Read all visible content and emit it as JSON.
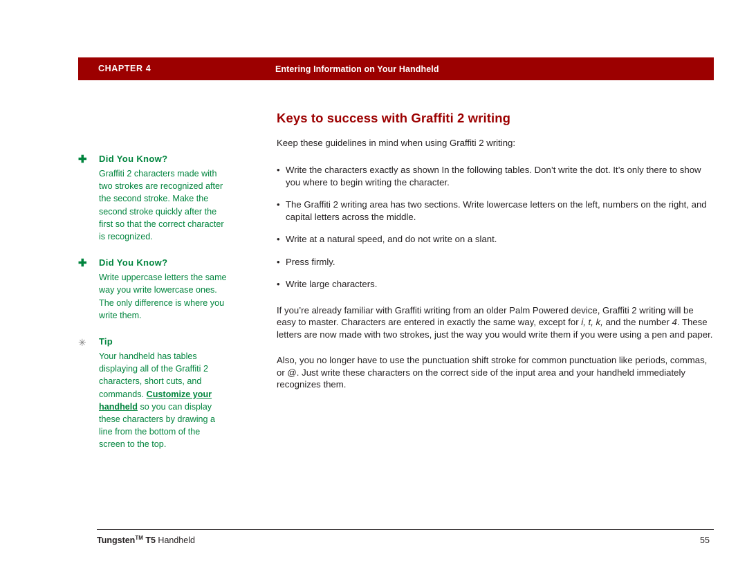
{
  "header": {
    "chapter_label": "CHAPTER 4",
    "section_title": "Entering Information on Your Handheld",
    "bar_color": "#9C0000"
  },
  "sidebar": {
    "accent_color": "#00843D",
    "notes": [
      {
        "marker": "plus-icon",
        "marker_glyph": "✚",
        "heading": "Did You Know?",
        "body": "Graffiti 2 characters made with two strokes are recognized after the second stroke. Make the second stroke quickly after the first so that the correct character is recognized."
      },
      {
        "marker": "plus-icon",
        "marker_glyph": "✚",
        "heading": "Did You Know?",
        "body": "Write uppercase letters the same way you write lowercase ones. The only difference is where you write them."
      },
      {
        "marker": "asterisk-icon",
        "marker_glyph": "✳",
        "heading": "Tip",
        "body_before_link": "Your handheld has tables displaying all of the Graffiti 2 characters, short cuts, and commands. ",
        "link_text": "Customize your handheld",
        "body_after_link": " so you can display these characters by drawing a line from the bottom of the screen to the top."
      }
    ]
  },
  "main": {
    "title": "Keys to success with Graffiti 2 writing",
    "title_color": "#9C0000",
    "intro": "Keep these guidelines in mind when using Graffiti 2 writing:",
    "bullets": [
      "Write the characters exactly as shown In the following tables. Don’t write the dot. It’s only there to show you where to begin writing the character.",
      "The Graffiti 2 writing area has two sections. Write lowercase letters on the left, numbers on the right, and capital letters across the middle.",
      "Write at a natural speed, and do not write on a slant.",
      "Press firmly.",
      "Write large characters."
    ],
    "bullet_glyph": "•",
    "paragraph_1_parts": {
      "a": "If you’re already familiar with Graffiti writing from an older Palm Powered device, Graffiti 2 writing will be easy to master. Characters are entered in exactly the same way, except for ",
      "italic_1": "i, t, k,",
      "b": " and the number ",
      "italic_2": "4",
      "c": ". These letters are now made with two strokes, just the way you would write them if you were using a pen and paper."
    },
    "paragraph_2": "Also, you no longer have to use the punctuation shift stroke for common punctuation like periods, commas, or @. Just write these characters on the correct side of the input area and your handheld immediately recognizes them."
  },
  "footer": {
    "product_bold": "Tungsten",
    "product_tm": "TM",
    "product_model": " T5",
    "product_light": " Handheld",
    "page_number": "55"
  }
}
